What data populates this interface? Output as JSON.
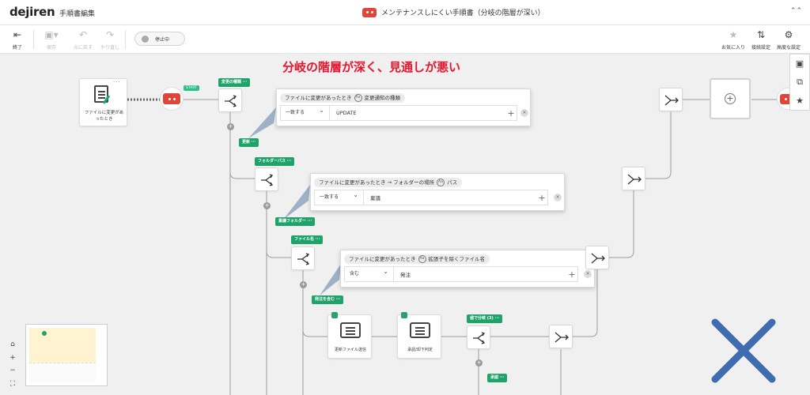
{
  "header": {
    "logo": "dejiren",
    "app_title": "手順書編集",
    "doc_title": "メンテナンスしにくい手順書（分岐の階層が深い）"
  },
  "toolbar": {
    "exit": "終了",
    "save": "保存",
    "undo": "元に戻す",
    "redo": "やり直し",
    "stop": "停止中",
    "favorite": "お気に入り",
    "connection": "接続設定",
    "advanced": "高度な設定"
  },
  "annotation": "分岐の階層が深く、見通しが悪い",
  "trigger": {
    "label_line1": "ファイルに変更があ",
    "label_line2": "ったとき",
    "start_badge": "START"
  },
  "branches": [
    {
      "tag": "変更の種類",
      "condition_source": "ファイルに変更があったとき",
      "condition_field": "変更通知の種類",
      "operator": "一致する",
      "value": "UPDATE",
      "case_tag": "更新"
    },
    {
      "tag": "フォルダーパス",
      "condition_source": "ファイルに変更があったとき → フォルダーの場所",
      "condition_field": "パス",
      "operator": "一致する",
      "value": "稟議",
      "case_tag": "稟議フォルダー"
    },
    {
      "tag": "ファイル名",
      "condition_source": "ファイルに変更があったとき",
      "condition_field": "拡張子を除くファイル名",
      "operator": "含む",
      "value": "発注",
      "case_tag": "発注を含む"
    },
    {
      "tag": "値で分岐 (3)",
      "case_tag": "承認"
    }
  ],
  "ab_icon": "Aa",
  "actions": {
    "notify": "更新ファイル送信",
    "approve": "承認/却下判定"
  },
  "ellipsis": "···",
  "colors": {
    "brand_green": "#1fa36b",
    "robot_red": "#e0453a",
    "annotation_red": "#e8142c",
    "cross_blue": "#3f6cb0"
  },
  "icons": {
    "exit": "exit-icon",
    "save": "save-icon",
    "undo": "undo-icon",
    "redo": "redo-icon",
    "favorite": "star-icon",
    "connection": "connection-icon",
    "advanced": "gear-icon",
    "zoom_home": "home-icon",
    "zoom_in": "plus-icon",
    "zoom_out": "minus-icon",
    "fit": "fit-icon"
  }
}
